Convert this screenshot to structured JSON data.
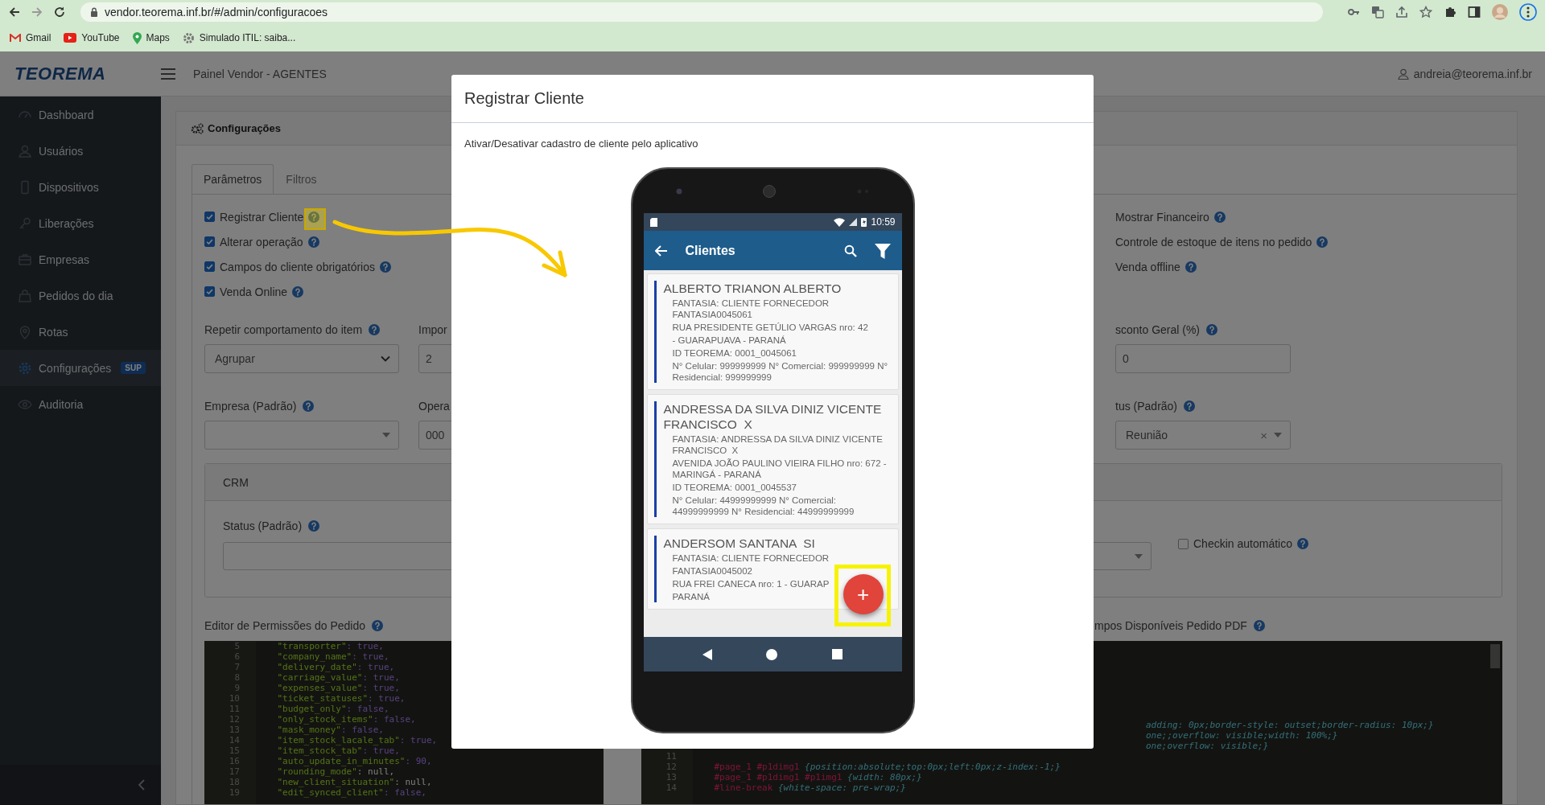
{
  "browser": {
    "url": "vendor.teorema.inf.br/#/admin/configuracoes",
    "bookmarks": [
      "Gmail",
      "YouTube",
      "Maps",
      "Simulado ITIL: saiba..."
    ]
  },
  "header": {
    "logo": "TEOREMA",
    "title": "Painel Vendor - AGENTES",
    "user": "andreia@teorema.inf.br"
  },
  "sidebar": {
    "items": [
      {
        "label": "Dashboard",
        "selected": false
      },
      {
        "label": "Usuários",
        "selected": false
      },
      {
        "label": "Dispositivos",
        "selected": false
      },
      {
        "label": "Liberações",
        "selected": false
      },
      {
        "label": "Empresas",
        "selected": false
      },
      {
        "label": "Pedidos do dia",
        "selected": false
      },
      {
        "label": "Rotas",
        "selected": false
      },
      {
        "label": "Configurações",
        "selected": true,
        "badge": "SUP"
      },
      {
        "label": "Auditoria",
        "selected": false
      }
    ]
  },
  "panel": {
    "title": "Configurações",
    "tabs": [
      {
        "label": "Parâmetros",
        "selected": true
      },
      {
        "label": "Filtros",
        "selected": false
      }
    ],
    "options": [
      {
        "label": "Registrar Cliente",
        "checked": true
      },
      {
        "label": "Alterar operação",
        "checked": true
      },
      {
        "label": "Campos do cliente obrigatórios",
        "checked": true
      },
      {
        "label": "Venda Online",
        "checked": true
      }
    ],
    "right_options": [
      {
        "label": "Mostrar Financeiro"
      },
      {
        "label": "Controle de estoque de itens no pedido"
      },
      {
        "label": "Venda offline"
      }
    ],
    "field_rows": [
      [
        {
          "label": "Repetir comportamento do item",
          "help": true,
          "kind": "native-select",
          "value": "Agrupar"
        },
        {
          "label": "Impor",
          "help": false,
          "kind": "input",
          "value": "2"
        },
        {
          "label": "sconto Geral (%)",
          "help": true,
          "kind": "input",
          "value": "0"
        }
      ],
      [
        {
          "label": "Empresa (Padrão)",
          "help": true,
          "kind": "select"
        },
        {
          "label": "Opera",
          "help": false,
          "kind": "input",
          "value": "000"
        },
        {
          "label": "tus (Padrão)",
          "help": true,
          "kind": "select",
          "value": "Reunião",
          "clear": "×"
        }
      ]
    ],
    "crm": {
      "title": "CRM",
      "status_label": "Status (Padrão)",
      "checkin": {
        "label": "Checkin automático",
        "checked": false
      }
    },
    "permissions_editor": {
      "title": "Editor de Permissões do Pedido",
      "lines": [
        {
          "number": "5",
          "key": "\"transporter\"",
          "rest": ": true,",
          "kind": "literal"
        },
        {
          "number": "6",
          "key": "\"company_name\"",
          "rest": ": true,",
          "kind": "literal"
        },
        {
          "number": "7",
          "key": "\"delivery_date\"",
          "rest": ": true,",
          "kind": "literal"
        },
        {
          "number": "8",
          "key": "\"carriage_value\"",
          "rest": ": true,",
          "kind": "literal"
        },
        {
          "number": "9",
          "key": "\"expenses_value\"",
          "rest": ": true,",
          "kind": "literal"
        },
        {
          "number": "10",
          "key": "\"ticket_statuses\"",
          "rest": ": true,",
          "kind": "literal"
        },
        {
          "number": "11",
          "key": "\"budget_only\"",
          "rest": ": false,",
          "kind": "literal"
        },
        {
          "number": "12",
          "key": "\"only_stock_items\"",
          "rest": ": false,",
          "kind": "literal"
        },
        {
          "number": "13",
          "key": "\"mask_money\"",
          "rest": ": false,",
          "kind": "literal"
        },
        {
          "number": "14",
          "key": "\"item_stock_lacale_tab\"",
          "rest": ": true,",
          "kind": "literal"
        },
        {
          "number": "15",
          "key": "\"item_stock_tab\"",
          "rest": ": true,",
          "kind": "literal"
        },
        {
          "number": "16",
          "key": "\"auto_update_in_minutes\"",
          "rest": ": 90,",
          "kind": "literal"
        },
        {
          "number": "17",
          "key": "\"rounding_mode\"",
          "rest": ": null,",
          "kind": "plain"
        },
        {
          "number": "18",
          "key": "\"new_client_situation\"",
          "rest": ": null,",
          "kind": "plain"
        },
        {
          "number": "19",
          "key": "\"edit_synced_client\"",
          "rest": ": false,",
          "kind": "literal"
        }
      ]
    },
    "pdf_editor": {
      "title": "mpos Disponíveis Pedido PDF",
      "lines": [
        {
          "kind": "fragment",
          "body": "adding: 0px;border-style: outset;border-radius: 10px;}"
        },
        {
          "kind": "fragment",
          "body": "one;;overflow: visible;width: 100%;}"
        },
        {
          "kind": "fragment",
          "body": "one;overflow: visible;}"
        },
        {
          "kind": "empty",
          "number": "11"
        },
        {
          "kind": "rule",
          "number": "12",
          "selector": "#page_1 #p1dimg1",
          "body": " {position:absolute;top:0px;left:0px;z-index:-1;}"
        },
        {
          "kind": "rule",
          "number": "13",
          "selector": "#page_1 #p1dimg1 #p1img1",
          "body": " {width: 80px;}"
        },
        {
          "kind": "rule",
          "number": "14",
          "selector": "#line-break",
          "body": " {white-space: pre-wrap;}"
        }
      ]
    }
  },
  "modal": {
    "title": "Registrar Cliente",
    "description": "Ativar/Desativar cadastro de cliente pelo aplicativo",
    "phone": {
      "time": "10:59",
      "title": "Clientes",
      "clients": [
        {
          "name": "ALBERTO TRIANON ALBERTO",
          "lines": [
            "FANTASIA: CLIENTE FORNECEDOR FANTASIA0045061",
            "RUA PRESIDENTE GETÚLIO VARGAS nro: 42",
            "- GUARAPUAVA - PARANÁ",
            "ID TEOREMA: 0001_0045061",
            "N° Celular: 999999999 N° Comercial: 999999999 N° Residencial: 999999999"
          ]
        },
        {
          "name": "ANDRESSA DA SILVA DINIZ VICENTE FRANCISCO  X",
          "lines": [
            "FANTASIA: ANDRESSA DA SILVA DINIZ VICENTE FRANCISCO  X",
            "AVENIDA JOÃO PAULINO VIEIRA FILHO nro: 672 - MARINGÁ - PARANÁ",
            "ID TEOREMA: 0001_0045537",
            "N° Celular: 44999999999 N° Comercial: 44999999999 N° Residencial: 44999999999"
          ]
        },
        {
          "name": "ANDERSOM SANTANA  SI",
          "lines": [
            "FANTASIA: CLIENTE FORNECEDOR",
            "FANTASIA0045002",
            "RUA FREI CANECA nro: 1 - GUARAP",
            "PARANÁ"
          ]
        }
      ],
      "fab": "+"
    }
  }
}
